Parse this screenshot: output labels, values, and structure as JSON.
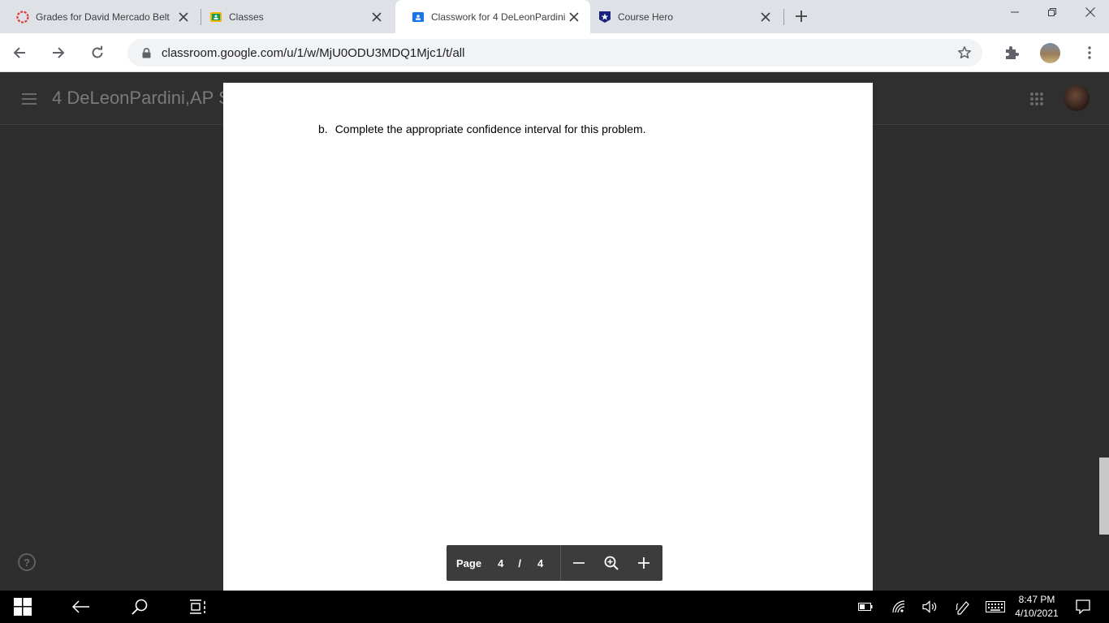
{
  "browser": {
    "tabs": [
      {
        "title": "Grades for David Mercado Belt",
        "active": false
      },
      {
        "title": "Classes",
        "active": false
      },
      {
        "title": "Classwork for 4 DeLeonPardini",
        "active": true
      },
      {
        "title": "Course Hero",
        "active": false
      }
    ],
    "url": "classroom.google.com/u/1/w/MjU0ODU3MDQ1Mjc1/t/all"
  },
  "classroom": {
    "class_title": "4 DeLeonPardini,AP S"
  },
  "document": {
    "question_label": "b.",
    "question_text": "Complete the appropriate confidence interval for this problem."
  },
  "pager": {
    "page_label": "Page",
    "current_page": "4",
    "separator": "/",
    "total_pages": "4"
  },
  "taskbar": {
    "time": "8:47 PM",
    "date": "4/10/2021"
  },
  "colors": {
    "tab_strip": "#dee1e6",
    "viewer_bg": "#2d2d2d",
    "pager_bg": "#3c3c3c",
    "taskbar": "#000000"
  }
}
